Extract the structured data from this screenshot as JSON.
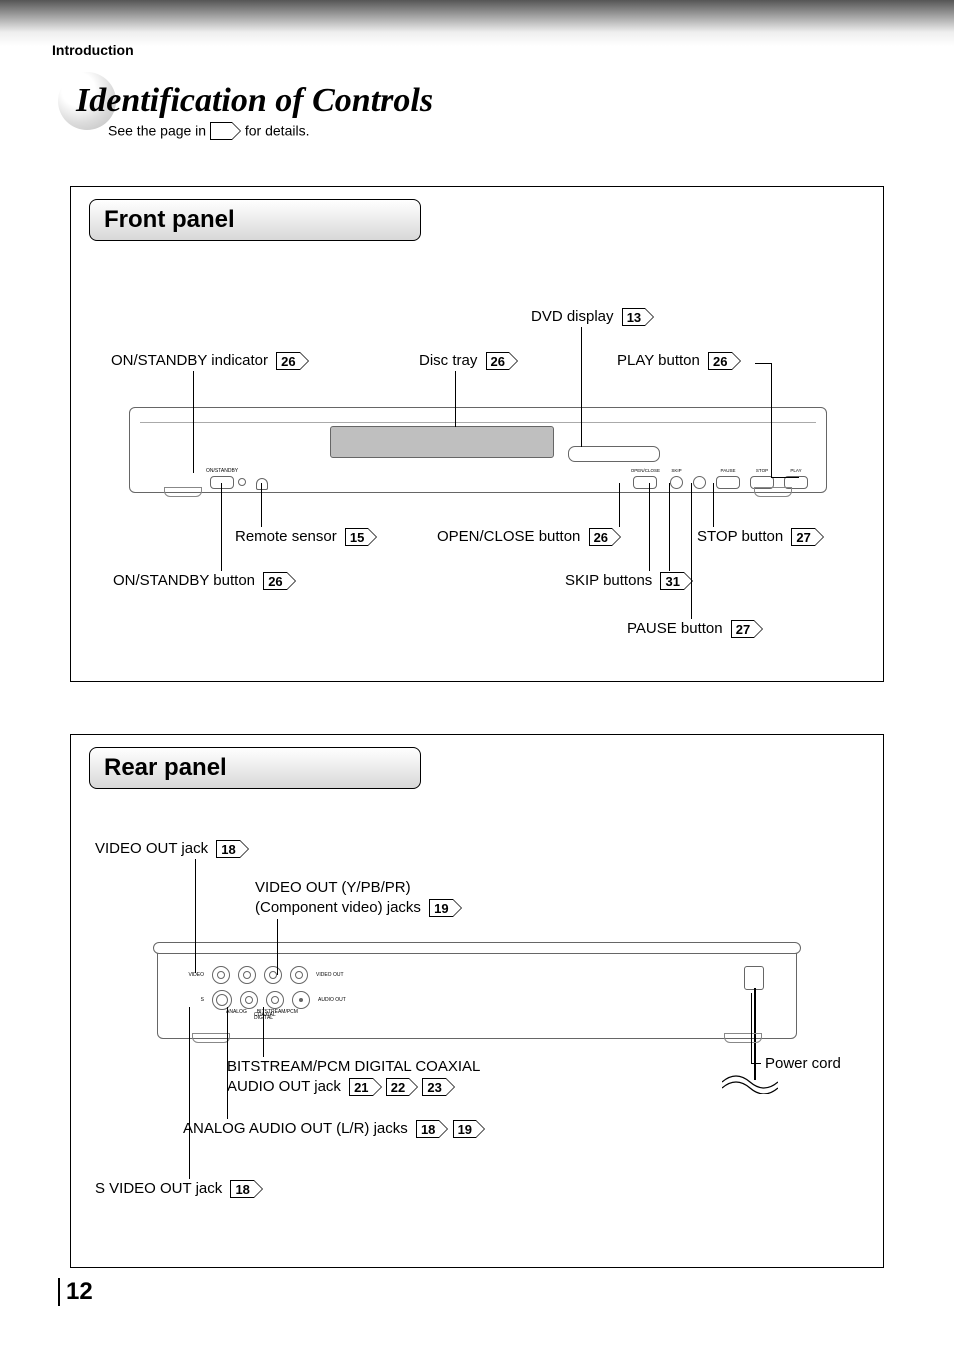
{
  "header": {
    "section": "Introduction"
  },
  "title": "Identification of Controls",
  "subtitle_before": "See the page in ",
  "subtitle_after": " for details.",
  "page_number": "12",
  "front": {
    "tab": "Front panel",
    "callouts": {
      "dvd_display": {
        "text": "DVD display",
        "page": "13"
      },
      "on_standby_ind": {
        "text": "ON/STANDBY indicator",
        "page": "26"
      },
      "disc_tray": {
        "text": "Disc tray",
        "page": "26"
      },
      "play": {
        "text": "PLAY button",
        "page": "26"
      },
      "remote_sensor": {
        "text": "Remote sensor",
        "page": "15"
      },
      "open_close": {
        "text": "OPEN/CLOSE button",
        "page": "26"
      },
      "stop": {
        "text": "STOP button",
        "page": "27"
      },
      "on_standby_btn": {
        "text": "ON/STANDBY button",
        "page": "26"
      },
      "skip": {
        "text": "SKIP buttons",
        "page": "31"
      },
      "pause": {
        "text": "PAUSE button",
        "page": "27"
      }
    },
    "mini_labels": {
      "onstandby": "ON/STANDBY",
      "io": "I /",
      "open_close": "OPEN/CLOSE",
      "skip": "SKIP",
      "pause": "PAUSE",
      "stop": "STOP",
      "play": "PLAY"
    }
  },
  "rear": {
    "tab": "Rear panel",
    "callouts": {
      "video_out": {
        "text": "VIDEO OUT jack",
        "page": "18"
      },
      "component": {
        "line1": "VIDEO OUT (Y/PB/PR)",
        "line2": "(Component video) jacks",
        "page": "19"
      },
      "coax": {
        "line1": "BITSTREAM/PCM DIGITAL COAXIAL",
        "line2": "AUDIO OUT jack",
        "pages": [
          "21",
          "22",
          "23"
        ]
      },
      "analog": {
        "text": "ANALOG AUDIO OUT (L/R) jacks",
        "pages": [
          "18",
          "19"
        ]
      },
      "svideo": {
        "text": "S VIDEO OUT jack",
        "page": "18"
      },
      "power_cord": {
        "text": "Power cord"
      }
    },
    "jack_labels": {
      "video": "VIDEO",
      "video_out": "VIDEO OUT",
      "s": "S",
      "analog": "ANALOG",
      "coaxial": "COAXIAL",
      "bitstream": "BITSTREAM/PCM",
      "digital": "DIGITAL",
      "audio_out": "AUDIO OUT"
    }
  }
}
